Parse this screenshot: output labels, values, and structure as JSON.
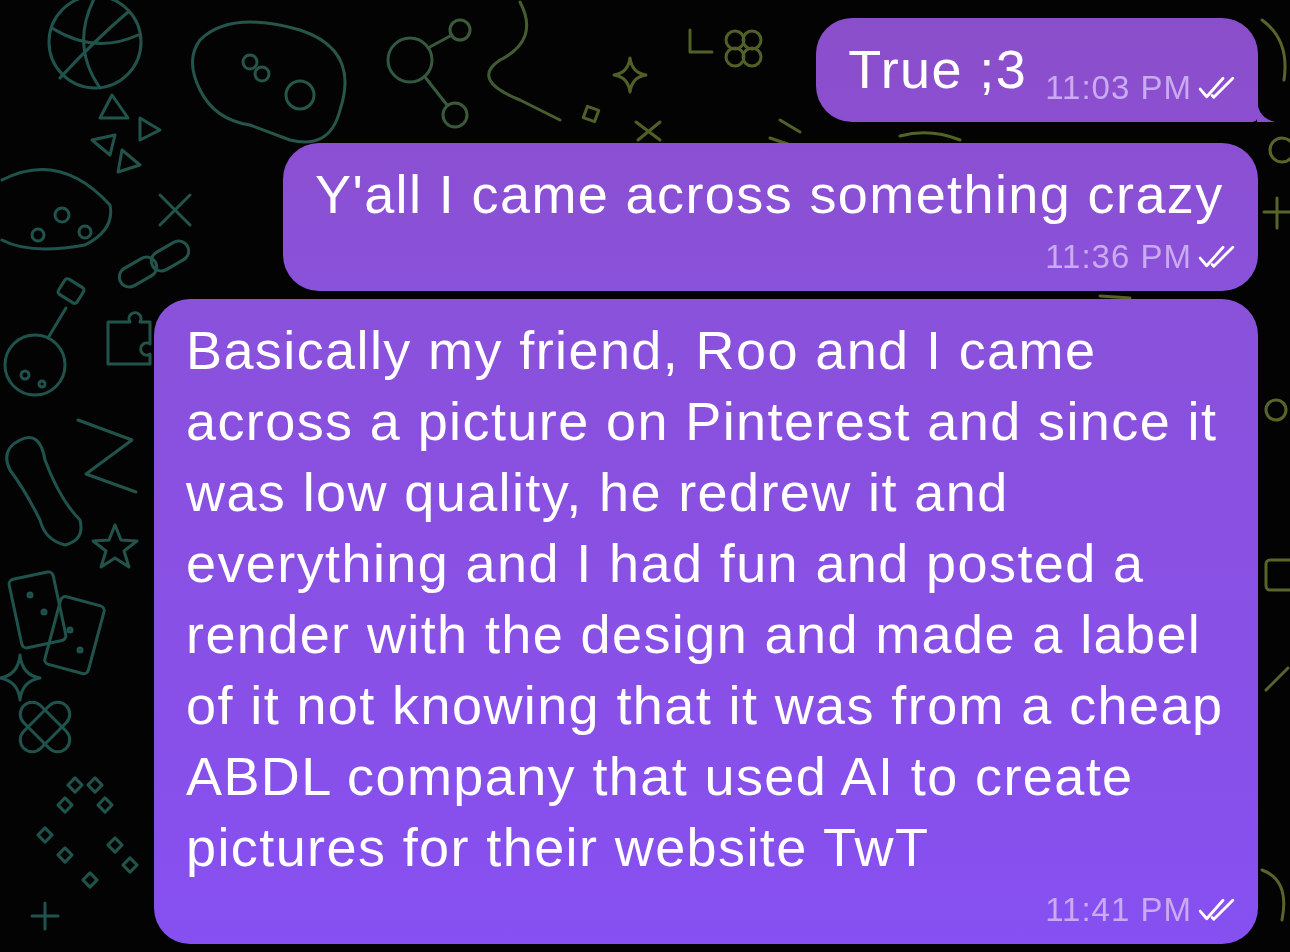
{
  "messages": [
    {
      "text": "True ;3",
      "time": "11:03 PM",
      "read": true,
      "tail": true
    },
    {
      "text": "Y'all I came across something crazy",
      "time": "11:36 PM",
      "read": true,
      "tail": false
    },
    {
      "text": "Basically my friend, Roo and I came across a picture on Pinterest and since it was low quality, he redrew it and everything and I had fun and posted a render with the design and made a label of it not knowing that it was from a cheap ABDL company that used AI to create pictures for their website TwT",
      "time": "11:41 PM",
      "read": true,
      "tail": false
    }
  ]
}
